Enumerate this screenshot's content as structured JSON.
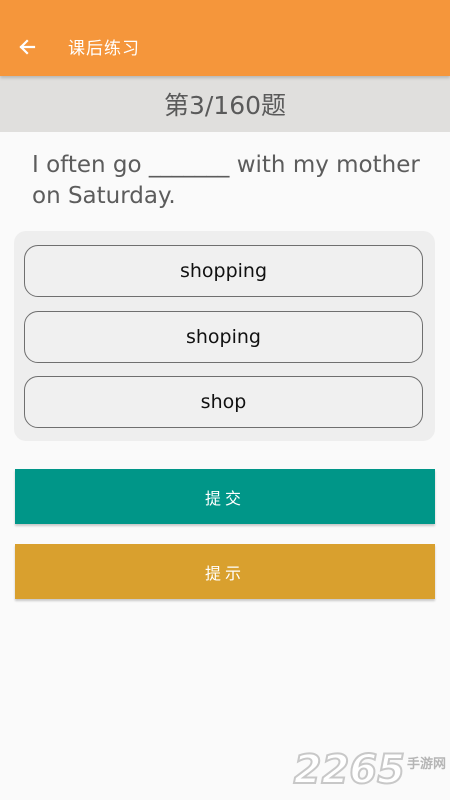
{
  "app_bar": {
    "title": "课后练习",
    "back_icon": "arrow-left-icon",
    "color": "#f5963b"
  },
  "progress": {
    "text": "第3/160题"
  },
  "question": {
    "text": "I often go _______ with my mother on Saturday."
  },
  "options": [
    {
      "label": "shopping"
    },
    {
      "label": "shoping"
    },
    {
      "label": "shop"
    }
  ],
  "actions": {
    "submit_label": "提交",
    "hint_label": "提示",
    "submit_color": "#009688",
    "hint_color": "#d9a02e"
  },
  "watermark": {
    "number": "2265",
    "text": "手游网"
  }
}
